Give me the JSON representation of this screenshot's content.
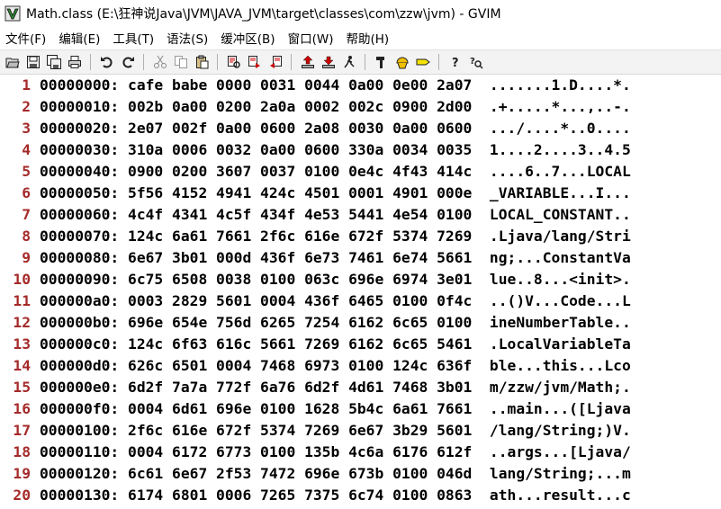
{
  "window": {
    "title": "Math.class (E:\\狂神说Java\\JVM\\JAVA_JVM\\target\\classes\\com\\zzw\\jvm) - GVIM"
  },
  "menu": [
    "文件(F)",
    "编辑(E)",
    "工具(T)",
    "语法(S)",
    "缓冲区(B)",
    "窗口(W)",
    "帮助(H)"
  ],
  "toolbar": {
    "groups": [
      [
        "open-icon",
        "save-icon",
        "save-all-icon",
        "print-icon"
      ],
      [
        "undo-icon",
        "redo-icon"
      ],
      [
        "cut-icon",
        "copy-icon",
        "paste-icon"
      ],
      [
        "find-replace-icon",
        "find-next-icon",
        "find-prev-icon"
      ],
      [
        "load-session-icon",
        "save-session-icon",
        "run-script-icon"
      ],
      [
        "make-icon",
        "shell-icon",
        "tags-icon"
      ],
      [
        "help-icon",
        "find-help-icon"
      ]
    ]
  },
  "editor": {
    "lines": [
      {
        "num": "1",
        "text": "00000000: cafe babe 0000 0031 0044 0a00 0e00 2a07  .......1.D....*."
      },
      {
        "num": "2",
        "text": "00000010: 002b 0a00 0200 2a0a 0002 002c 0900 2d00  .+.....*...,..-."
      },
      {
        "num": "3",
        "text": "00000020: 2e07 002f 0a00 0600 2a08 0030 0a00 0600  .../....*..0...."
      },
      {
        "num": "4",
        "text": "00000030: 310a 0006 0032 0a00 0600 330a 0034 0035  1....2....3..4.5"
      },
      {
        "num": "5",
        "text": "00000040: 0900 0200 3607 0037 0100 0e4c 4f43 414c  ....6..7...LOCAL"
      },
      {
        "num": "6",
        "text": "00000050: 5f56 4152 4941 424c 4501 0001 4901 000e  _VARIABLE...I..."
      },
      {
        "num": "7",
        "text": "00000060: 4c4f 4341 4c5f 434f 4e53 5441 4e54 0100  LOCAL_CONSTANT.."
      },
      {
        "num": "8",
        "text": "00000070: 124c 6a61 7661 2f6c 616e 672f 5374 7269  .Ljava/lang/Stri"
      },
      {
        "num": "9",
        "text": "00000080: 6e67 3b01 000d 436f 6e73 7461 6e74 5661  ng;...ConstantVa"
      },
      {
        "num": "10",
        "text": "00000090: 6c75 6508 0038 0100 063c 696e 6974 3e01  lue..8...<init>."
      },
      {
        "num": "11",
        "text": "000000a0: 0003 2829 5601 0004 436f 6465 0100 0f4c  ..()V...Code...L"
      },
      {
        "num": "12",
        "text": "000000b0: 696e 654e 756d 6265 7254 6162 6c65 0100  ineNumberTable.."
      },
      {
        "num": "13",
        "text": "000000c0: 124c 6f63 616c 5661 7269 6162 6c65 5461  .LocalVariableTa"
      },
      {
        "num": "14",
        "text": "000000d0: 626c 6501 0004 7468 6973 0100 124c 636f  ble...this...Lco"
      },
      {
        "num": "15",
        "text": "000000e0: 6d2f 7a7a 772f 6a76 6d2f 4d61 7468 3b01  m/zzw/jvm/Math;."
      },
      {
        "num": "16",
        "text": "000000f0: 0004 6d61 696e 0100 1628 5b4c 6a61 7661  ..main...([Ljava"
      },
      {
        "num": "17",
        "text": "00000100: 2f6c 616e 672f 5374 7269 6e67 3b29 5601  /lang/String;)V."
      },
      {
        "num": "18",
        "text": "00000110: 0004 6172 6773 0100 135b 4c6a 6176 612f  ..args...[Ljava/"
      },
      {
        "num": "19",
        "text": "00000120: 6c61 6e67 2f53 7472 696e 673b 0100 046d  lang/String;...m"
      },
      {
        "num": "20",
        "text": "00000130: 6174 6801 0006 7265 7375 6c74 0100 0863  ath...result...c"
      }
    ]
  }
}
